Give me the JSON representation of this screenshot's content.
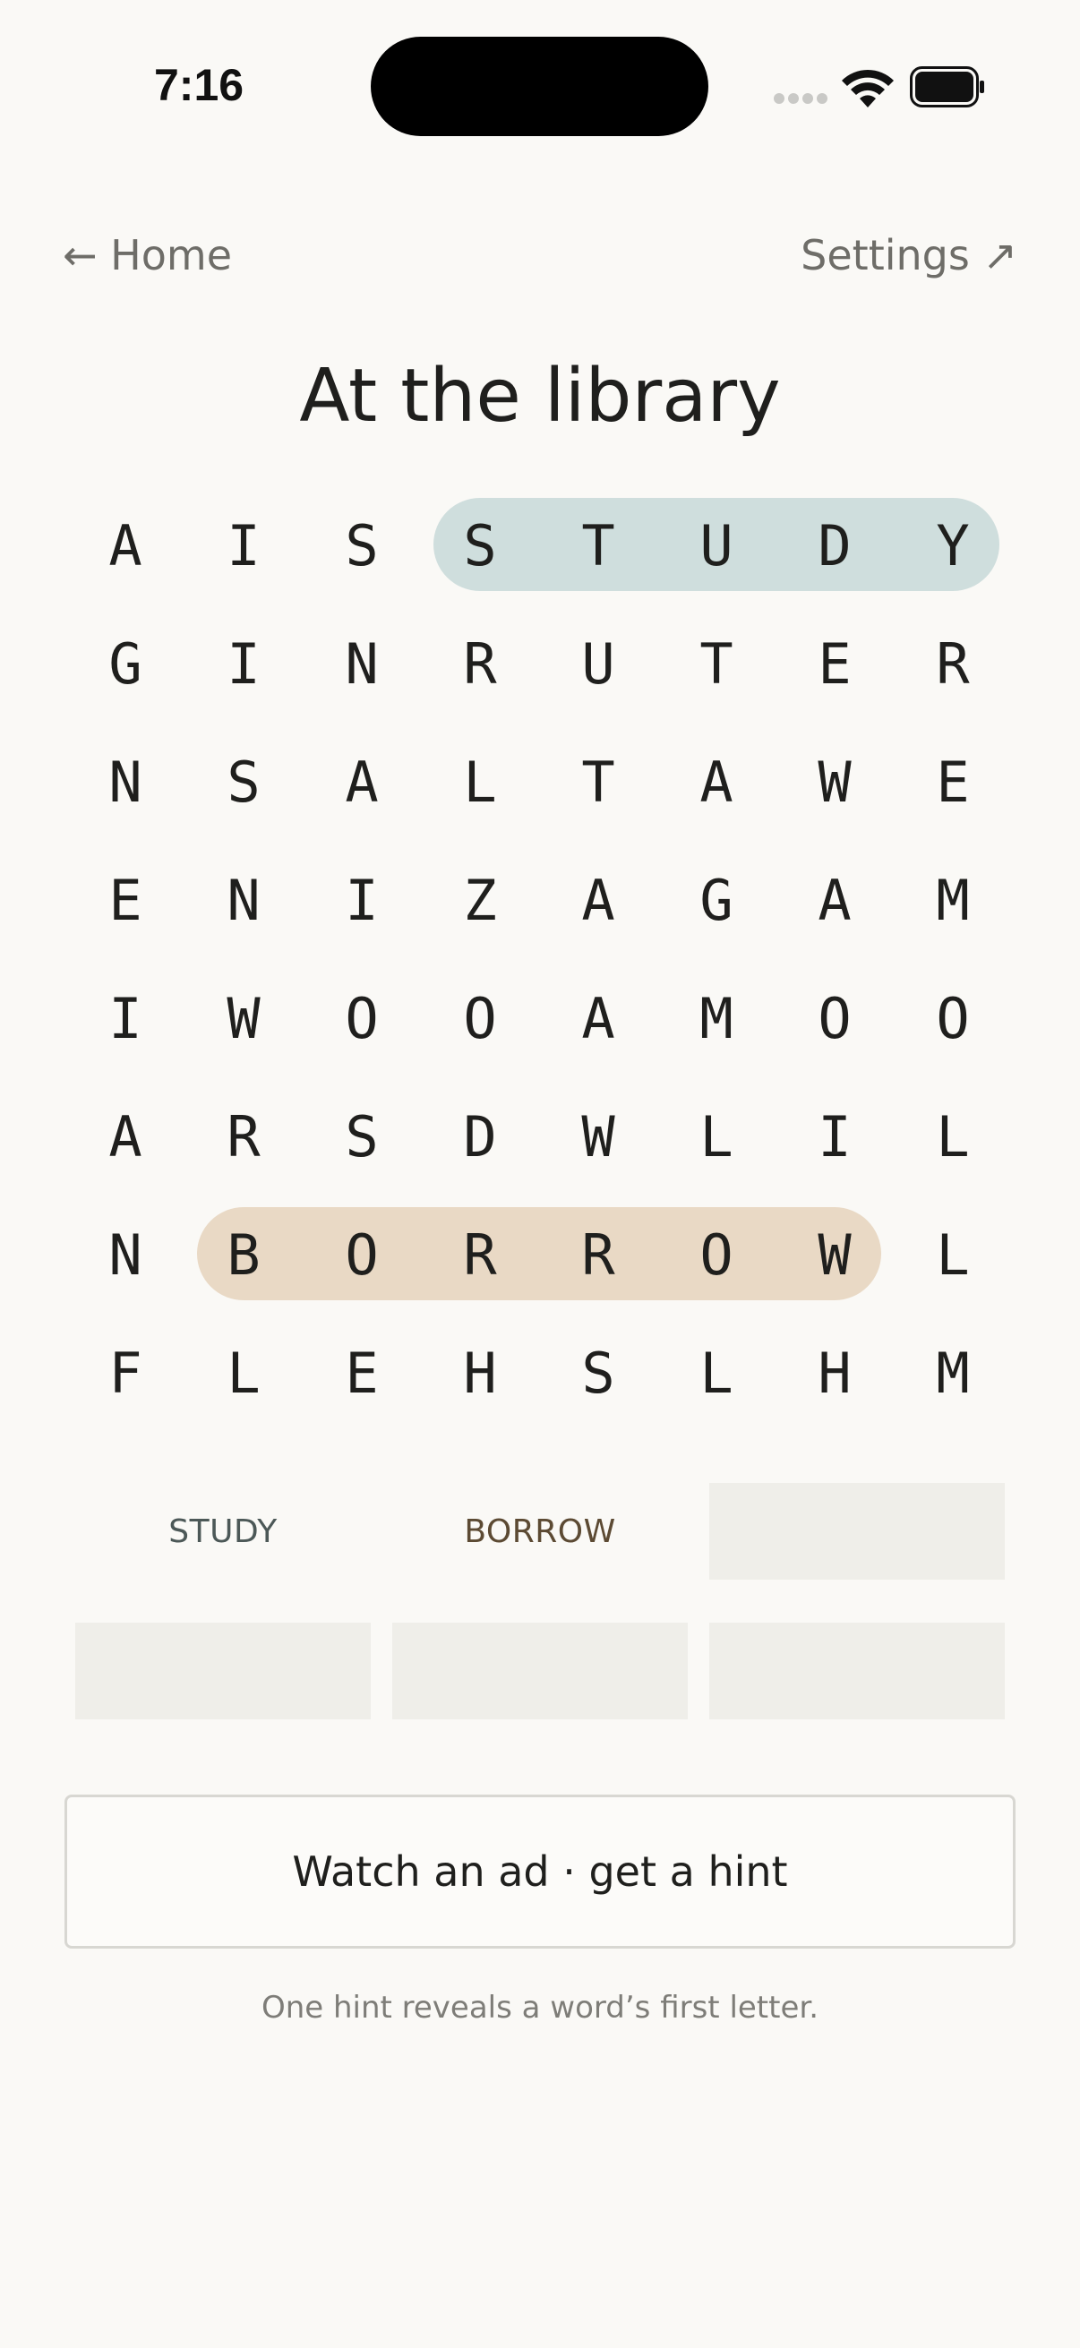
{
  "status_bar": {
    "time": "7:16"
  },
  "nav": {
    "home_label": "← Home",
    "settings_label": "Settings ↗"
  },
  "puzzle": {
    "title": "At the library",
    "grid": [
      [
        "A",
        "I",
        "S",
        "S",
        "T",
        "U",
        "D",
        "Y"
      ],
      [
        "G",
        "I",
        "N",
        "R",
        "U",
        "T",
        "E",
        "R"
      ],
      [
        "N",
        "S",
        "A",
        "L",
        "T",
        "A",
        "W",
        "E"
      ],
      [
        "E",
        "N",
        "I",
        "Z",
        "A",
        "G",
        "A",
        "M"
      ],
      [
        "I",
        "W",
        "O",
        "O",
        "A",
        "M",
        "O",
        "O"
      ],
      [
        "A",
        "R",
        "S",
        "D",
        "W",
        "L",
        "I",
        "L"
      ],
      [
        "N",
        "B",
        "O",
        "R",
        "R",
        "O",
        "W",
        "L"
      ],
      [
        "F",
        "L",
        "E",
        "H",
        "S",
        "L",
        "H",
        "M"
      ]
    ],
    "found_words": [
      {
        "word": "STUDY",
        "color": "#cfdedd"
      },
      {
        "word": "BORROW",
        "color": "#e9d9c5"
      }
    ],
    "word_slots": [
      "STUDY",
      "BORROW",
      "",
      "",
      "",
      ""
    ]
  },
  "hint": {
    "button_label": "Watch an ad · get a hint",
    "caption": "One hint reveals a word’s first letter."
  },
  "colors": {
    "background": "#faf9f6",
    "study_highlight": "#cfdedd",
    "borrow_highlight": "#e9d9c5",
    "empty_slot": "#efeee9"
  }
}
